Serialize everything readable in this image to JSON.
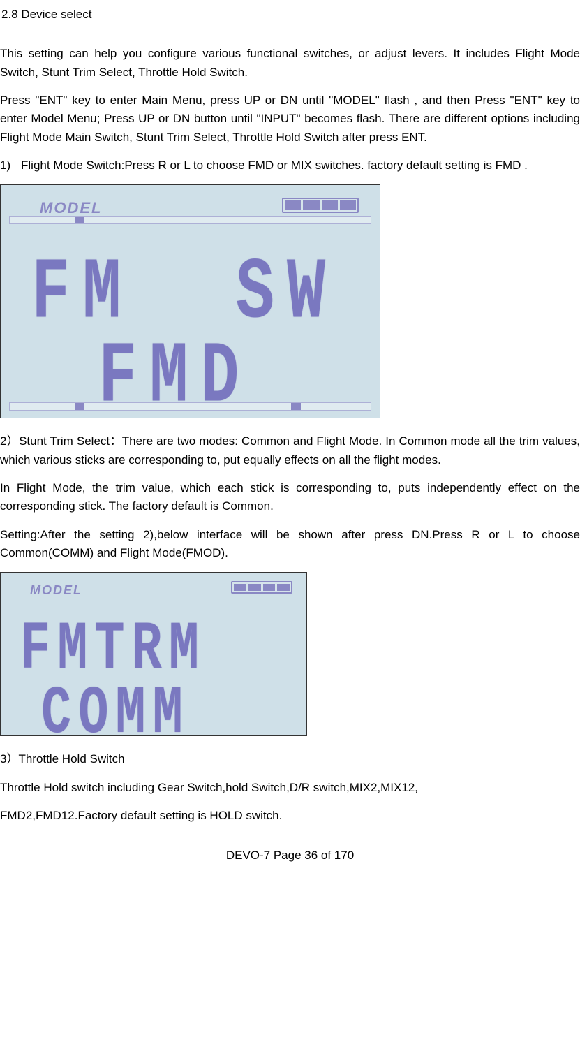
{
  "section_heading": "2.8 Device select",
  "para1": "This setting can help you configure various functional switches, or adjust levers. It includes Flight Mode Switch, Stunt Trim Select, Throttle Hold Switch.",
  "para2": "Press \"ENT\" key to enter Main Menu, press UP or DN until \"MODEL\" flash , and then Press \"ENT\" key to enter Model Menu; Press UP or DN button until \"INPUT\" becomes flash. There are different options including Flight Mode Main Switch, Stunt Trim Select, Throttle Hold Switch after press ENT.",
  "item1_num": "1)",
  "item1_txt": "Flight Mode Switch:Press R or L to choose FMD or MIX switches. factory default setting is FMD .",
  "lcd1": {
    "model": "MODEL",
    "row1": "FM  SW",
    "row2": "FMD"
  },
  "para3": "2）Stunt Trim Select：There are two modes: Common and Flight Mode. In Common mode all the trim values, which various sticks are corresponding to, put equally effects on all the flight modes.",
  "para4": "In Flight Mode, the trim value, which each stick is corresponding to, puts independently effect on the corresponding stick. The factory default is Common.",
  "para5": "Setting:After the setting 2),below interface will be shown after press DN.Press R or L to choose Common(COMM) and Flight Mode(FMOD).",
  "lcd2": {
    "model": "MODEL",
    "row1": "FMTRM",
    "row2": "COMM"
  },
  "para6": "3）Throttle Hold Switch",
  "para7": "Throttle Hold switch including Gear Switch,hold Switch,D/R switch,MIX2,MIX12,",
  "para8": "FMD2,FMD12.Factory default setting is HOLD switch.",
  "footer": "DEVO-7     Page 36 of 170"
}
